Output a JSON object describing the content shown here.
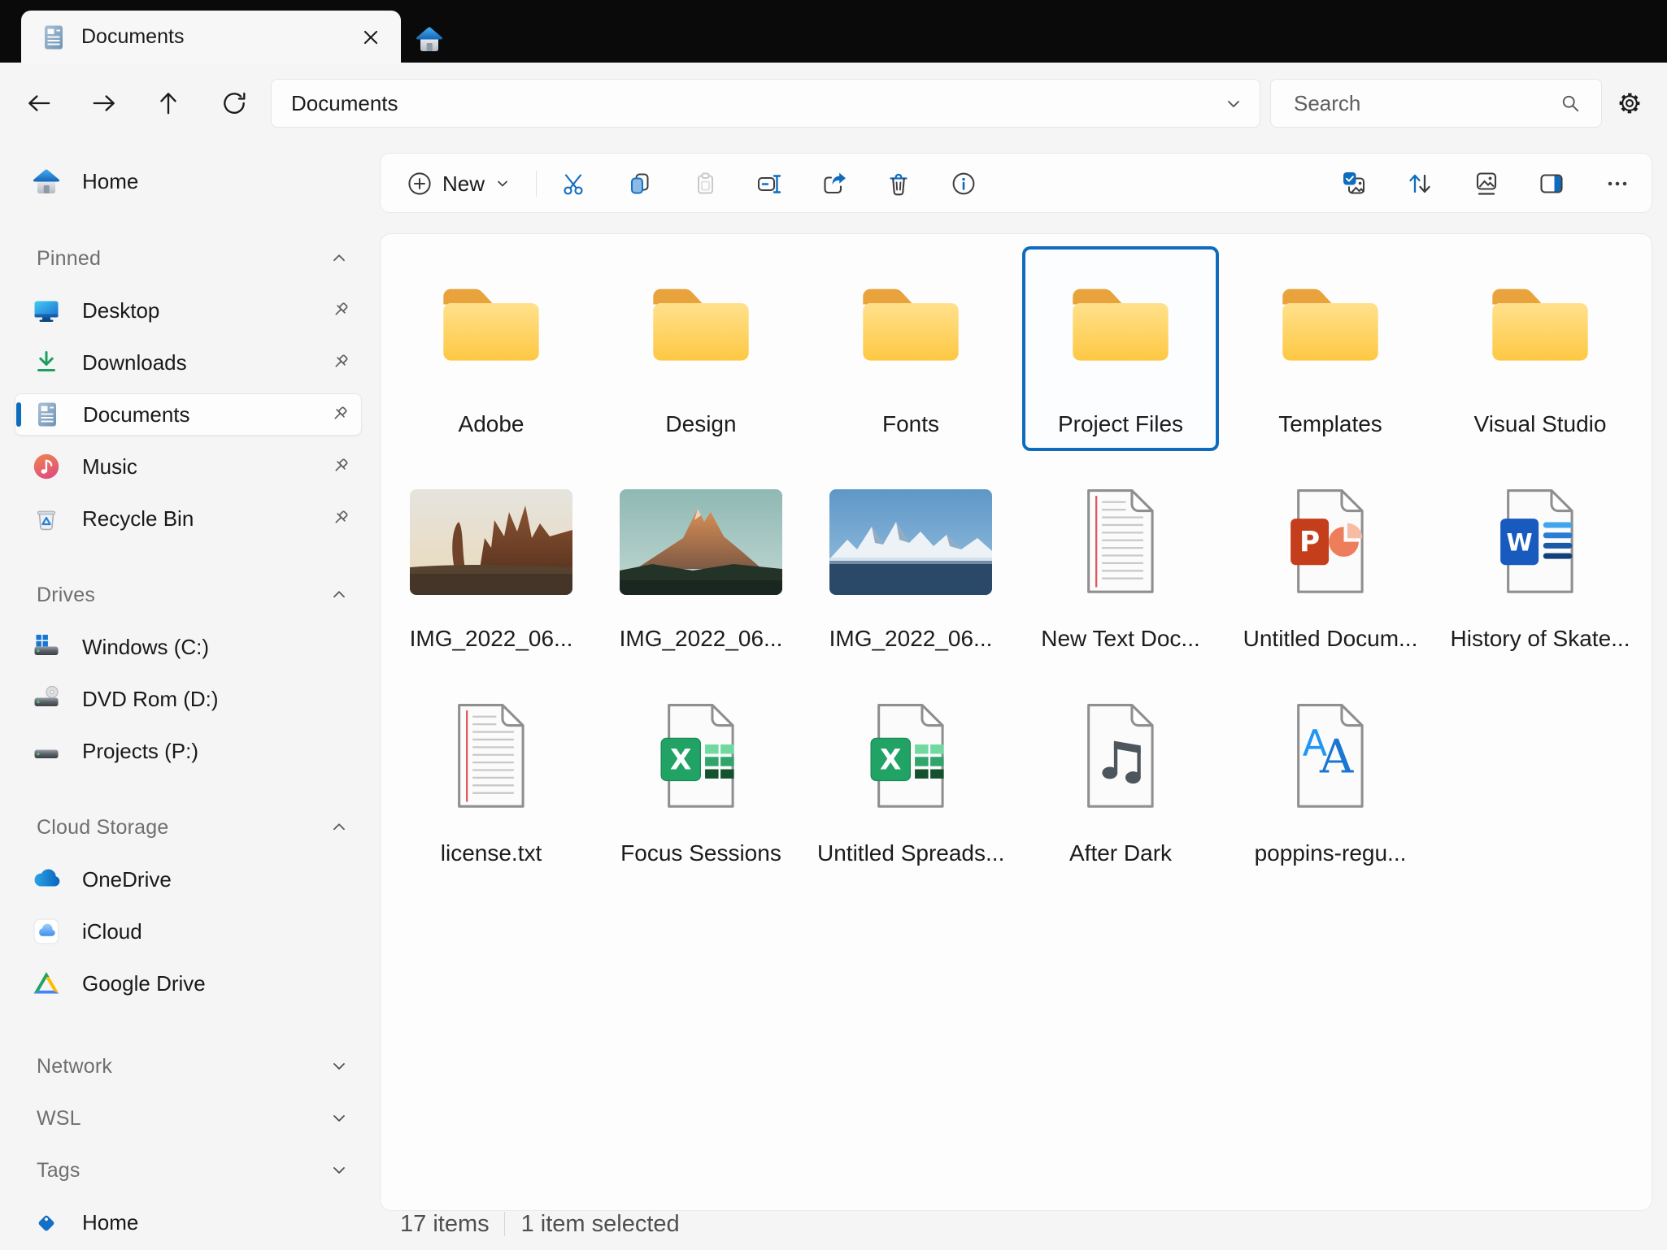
{
  "titlebar": {
    "tab_title": "Documents"
  },
  "toolbar": {
    "address": "Documents",
    "search_placeholder": "Search"
  },
  "command_bar": {
    "new_label": "New"
  },
  "sidebar": {
    "rows": [
      {
        "kind": "item",
        "id": "home",
        "label": "Home",
        "icon": "house"
      },
      {
        "kind": "header",
        "id": "pinned",
        "label": "Pinned",
        "chevron": "up"
      },
      {
        "kind": "item",
        "id": "desktop",
        "label": "Desktop",
        "icon": "monitor",
        "pin": true
      },
      {
        "kind": "item",
        "id": "downloads",
        "label": "Downloads",
        "icon": "download",
        "pin": true
      },
      {
        "kind": "item",
        "id": "documents",
        "label": "Documents",
        "icon": "document",
        "pin": true,
        "selected": true
      },
      {
        "kind": "item",
        "id": "music",
        "label": "Music",
        "icon": "music",
        "pin": true
      },
      {
        "kind": "item",
        "id": "recycle-bin",
        "label": "Recycle Bin",
        "icon": "recycle",
        "pin": true
      },
      {
        "kind": "header",
        "id": "drives",
        "label": "Drives",
        "chevron": "up"
      },
      {
        "kind": "item",
        "id": "windows-c",
        "label": "Windows (C:)",
        "icon": "drive-windows"
      },
      {
        "kind": "item",
        "id": "dvd-d",
        "label": "DVD Rom (D:)",
        "icon": "drive-dvd"
      },
      {
        "kind": "item",
        "id": "projects-p",
        "label": "Projects (P:)",
        "icon": "drive"
      },
      {
        "kind": "header",
        "id": "cloud-storage",
        "label": "Cloud Storage",
        "chevron": "up"
      },
      {
        "kind": "item",
        "id": "onedrive",
        "label": "OneDrive",
        "icon": "onedrive"
      },
      {
        "kind": "item",
        "id": "icloud",
        "label": "iCloud",
        "icon": "icloud"
      },
      {
        "kind": "item",
        "id": "google-drive",
        "label": "Google Drive",
        "icon": "gdrive"
      },
      {
        "kind": "header",
        "id": "network",
        "label": "Network",
        "chevron": "down"
      },
      {
        "kind": "header",
        "id": "wsl",
        "label": "WSL",
        "chevron": "down"
      },
      {
        "kind": "header",
        "id": "tags",
        "label": "Tags",
        "chevron": "down"
      },
      {
        "kind": "item",
        "id": "tag-home",
        "label": "Home",
        "icon": "tag"
      }
    ]
  },
  "files": [
    {
      "name": "Adobe",
      "icon": "folder"
    },
    {
      "name": "Design",
      "icon": "folder"
    },
    {
      "name": "Fonts",
      "icon": "folder"
    },
    {
      "name": "Project Files",
      "icon": "folder",
      "selected": true
    },
    {
      "name": "Templates",
      "icon": "folder"
    },
    {
      "name": "Visual Studio",
      "icon": "folder"
    },
    {
      "name": "IMG_2022_06...",
      "icon": "img-desert"
    },
    {
      "name": "IMG_2022_06...",
      "icon": "img-peak"
    },
    {
      "name": "IMG_2022_06...",
      "icon": "img-alps"
    },
    {
      "name": "New Text Doc...",
      "icon": "file-txt"
    },
    {
      "name": "Untitled Docum...",
      "icon": "file-ppt"
    },
    {
      "name": "History of Skate...",
      "icon": "file-word"
    },
    {
      "name": "license.txt",
      "icon": "file-txt"
    },
    {
      "name": "Focus Sessions",
      "icon": "file-excel"
    },
    {
      "name": "Untitled Spreads...",
      "icon": "file-excel"
    },
    {
      "name": "After Dark",
      "icon": "file-audio"
    },
    {
      "name": "poppins-regu...",
      "icon": "file-font"
    }
  ],
  "status_bar": {
    "items_count": "17 items",
    "selection": "1 item selected"
  },
  "colors": {
    "accent": "#0F6CBD",
    "selection_border": "#0F6CBD",
    "folder_body": "#FFC93F",
    "folder_tab": "#E8A33D"
  }
}
